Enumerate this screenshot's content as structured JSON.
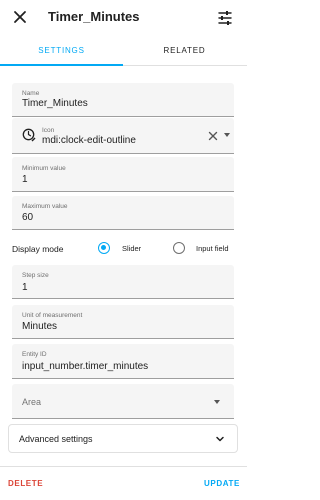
{
  "header": {
    "title": "Timer_Minutes",
    "close_icon": "close-icon",
    "settings_icon": "tune-icon"
  },
  "tabs": [
    {
      "label": "SETTINGS",
      "active": true
    },
    {
      "label": "RELATED",
      "active": false
    }
  ],
  "accent_color": "#03a9f4",
  "delete_color": "#db4437",
  "fields": {
    "name": {
      "label": "Name",
      "value": "Timer_Minutes"
    },
    "icon": {
      "label": "Icon",
      "value": "mdi:clock-edit-outline"
    },
    "minimum": {
      "label": "Minimum value",
      "value": "1"
    },
    "maximum": {
      "label": "Maximum value",
      "value": "60"
    },
    "step": {
      "label": "Step size",
      "value": "1"
    },
    "unit": {
      "label": "Unit of measurement",
      "value": "Minutes"
    },
    "entity_id": {
      "label": "Entity ID",
      "value": "input_number.timer_minutes"
    },
    "area": {
      "placeholder": "Area"
    }
  },
  "display_mode": {
    "label": "Display mode",
    "options": [
      {
        "label": "Slider",
        "selected": true
      },
      {
        "label": "Input field",
        "selected": false
      }
    ]
  },
  "advanced": {
    "label": "Advanced settings"
  },
  "footer": {
    "delete_label": "DELETE",
    "update_label": "UPDATE"
  }
}
